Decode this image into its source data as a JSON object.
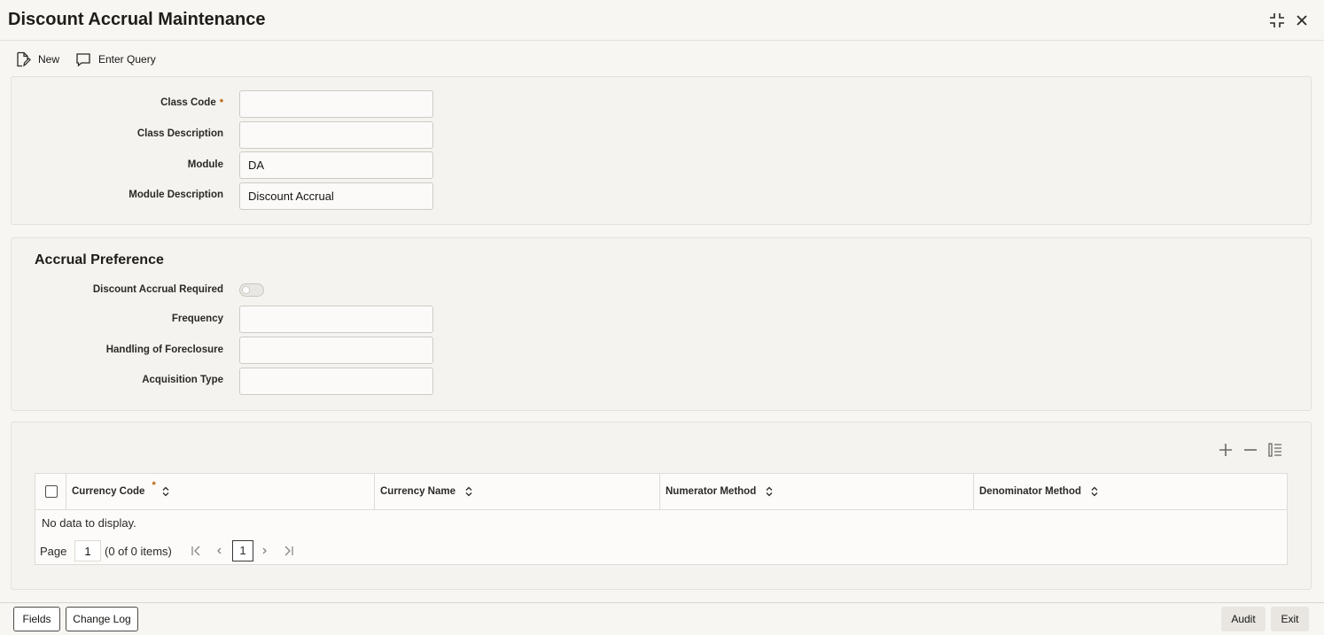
{
  "window": {
    "title": "Discount Accrual Maintenance"
  },
  "toolbar": {
    "new_label": "New",
    "enter_query_label": "Enter Query"
  },
  "main_form": {
    "class_code": {
      "label": "Class Code",
      "required_mark": "*",
      "value": ""
    },
    "class_description": {
      "label": "Class Description",
      "value": ""
    },
    "module": {
      "label": "Module",
      "value": "DA"
    },
    "module_description": {
      "label": "Module Description",
      "value": "Discount Accrual"
    }
  },
  "accrual_preference": {
    "title": "Accrual Preference",
    "discount_accrual_required": {
      "label": "Discount Accrual Required",
      "checked": false
    },
    "frequency": {
      "label": "Frequency",
      "value": ""
    },
    "handling_of_foreclosure": {
      "label": "Handling of Foreclosure",
      "value": ""
    },
    "acquisition_type": {
      "label": "Acquisition Type",
      "value": ""
    }
  },
  "currency_grid": {
    "columns": [
      {
        "label": "Currency Code",
        "required_mark": "*"
      },
      {
        "label": "Currency Name"
      },
      {
        "label": "Numerator Method"
      },
      {
        "label": "Denominator Method"
      }
    ],
    "rows": [],
    "empty_text": "No data to display.",
    "pagination": {
      "page_label": "Page",
      "page_value": "1",
      "count_text": "(0 of 0 items)",
      "current_page": "1"
    }
  },
  "footer": {
    "fields_label": "Fields",
    "change_log_label": "Change Log",
    "audit_label": "Audit",
    "exit_label": "Exit"
  },
  "colors": {
    "background": "#f7f6f3",
    "panel": "#f4f3f0",
    "required": "#b35c00"
  }
}
